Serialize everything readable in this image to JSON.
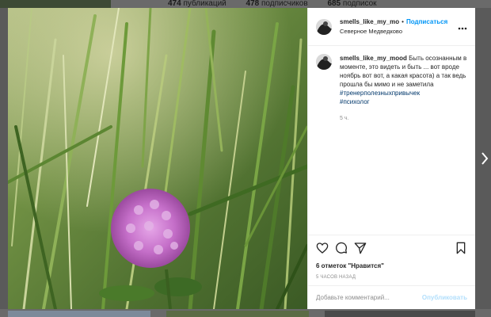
{
  "background": {
    "stats": [
      {
        "count": "474",
        "label": "публикаций"
      },
      {
        "count": "478",
        "label": "подписчиков"
      },
      {
        "count": "685",
        "label": "подписок"
      }
    ]
  },
  "post": {
    "username": "smells_like_my_mo",
    "separator": "•",
    "follow_label": "Подписаться",
    "location": "Северное Медведково",
    "more_icon": "more-horizontal-icon",
    "caption_username": "smells_like_my_mood",
    "caption_text": "Быть осознанным в моменте, это видеть и быть ... вот вроде ноябрь вот вот, а какая красота) а так ведь прошла бы мимо и не заметила",
    "hashtags": [
      "#тренерполезныхпривычек",
      "#психолог"
    ],
    "caption_time": "5 ч.",
    "likes_text": "6 отметок \"Нравится\"",
    "time_ago": "5 ЧАСОВ НАЗАД",
    "comment_placeholder": "Добавьте комментарий...",
    "publish_label": "Опубликовать"
  },
  "icons": {
    "like": "heart-icon",
    "comment": "comment-icon",
    "share": "paper-plane-icon",
    "save": "bookmark-icon",
    "next": "chevron-right-icon"
  },
  "colors": {
    "accent": "#0095f6",
    "hashtag": "#00376b",
    "publish_disabled": "#b2dffc",
    "muted": "#8e8e8e"
  }
}
